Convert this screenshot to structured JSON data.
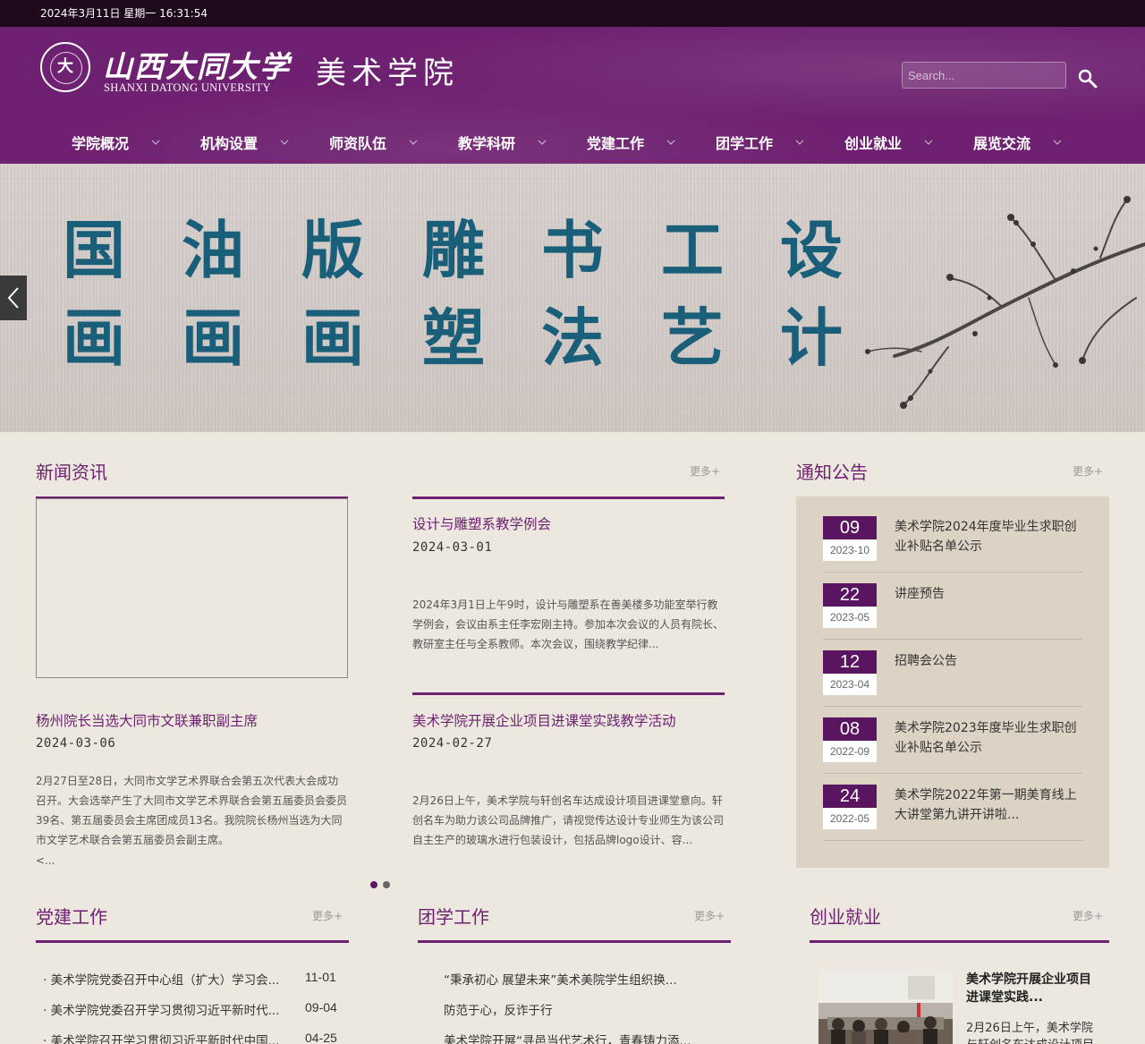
{
  "topbar": {
    "datetime": "2024年3月11日 星期一 16:31:54"
  },
  "header": {
    "logo_cn": "山西大同大学",
    "logo_en": "SHANXI DATONG UNIVERSITY",
    "college": "美术学院",
    "search_placeholder": "Search...",
    "brand_color": "#6e2170"
  },
  "nav": {
    "items": [
      {
        "label": "学院概况"
      },
      {
        "label": "机构设置"
      },
      {
        "label": "师资队伍"
      },
      {
        "label": "教学科研"
      },
      {
        "label": "党建工作"
      },
      {
        "label": "团学工作"
      },
      {
        "label": "创业就业"
      },
      {
        "label": "展览交流"
      }
    ]
  },
  "banner": {
    "columns": [
      [
        "国",
        "画"
      ],
      [
        "油",
        "画"
      ],
      [
        "版",
        "画"
      ],
      [
        "雕",
        "塑"
      ],
      [
        "书",
        "法"
      ],
      [
        "工",
        "艺"
      ],
      [
        "设",
        "计"
      ]
    ]
  },
  "news": {
    "title": "新闻资讯",
    "more": "更多+",
    "items": [
      {
        "title": "设计与雕塑系教学例会",
        "date": "2024-03-01",
        "body": "2024年3月1日上午9时，设计与雕塑系在善美楼多功能室举行教学例会，会议由系主任李宏刚主持。参加本次会议的人员有院长、教研室主任与全系教师。本次会议，围绕教学纪律..."
      },
      {
        "title": "杨州院长当选大同市文联兼职副主席",
        "date": "2024-03-06",
        "body": "2月27日至28日，大同市文学艺术界联合会第五次代表大会成功召开。大会选举产生了大同市文学艺术界联合会第五届委员会委员39名、第五届委员会主席团成员13名。我院院长杨州当选为大同市文学艺术联合会第五届委员会副主席。",
        "tail": "<..."
      },
      {
        "title": "美术学院开展企业项目进课堂实践教学活动",
        "date": "2024-02-27",
        "body": "2月26日上午，美术学院与轩创名车达成设计项目进课堂意向。轩创名车为助力该公司品牌推广，请视觉传达设计专业师生为该公司自主生产的玻璃水进行包装设计，包括品牌logo设计、容..."
      }
    ]
  },
  "notices": {
    "title": "通知公告",
    "more": "更多+",
    "items": [
      {
        "day": "09",
        "ym": "2023-10",
        "text": "美术学院2024年度毕业生求职创业补贴名单公示"
      },
      {
        "day": "22",
        "ym": "2023-05",
        "text": "讲座预告"
      },
      {
        "day": "12",
        "ym": "2023-04",
        "text": "招聘会公告"
      },
      {
        "day": "08",
        "ym": "2022-09",
        "text": "美术学院2023年度毕业生求职创业补贴名单公示"
      },
      {
        "day": "24",
        "ym": "2022-05",
        "text": "美术学院2022年第一期美育线上大讲堂第九讲开讲啦..."
      }
    ]
  },
  "party": {
    "title": "党建工作",
    "more": "更多+",
    "items": [
      {
        "text": "· 美术学院党委召开中心组（扩大）学习会...",
        "date": "11-01"
      },
      {
        "text": "· 美术学院党委召开学习贯彻习近平新时代...",
        "date": "09-04"
      },
      {
        "text": "· 美术学院召开学习贯彻习近平新时代中国...",
        "date": "04-25"
      }
    ]
  },
  "league": {
    "title": "团学工作",
    "more": "更多+",
    "items": [
      {
        "text": "“秉承初心 展望未来”美术美院学生组织换..."
      },
      {
        "text": "防范于心，反诈于行"
      },
      {
        "text": "美术学院开展“寻邑当代艺术行，青春铸力添..."
      }
    ]
  },
  "career": {
    "title": "创业就业",
    "more": "更多+",
    "feature_title": "美术学院开展企业项目进课堂实践...",
    "feature_body": "2月26日上午，美术学院与轩创名车达成设计项目"
  }
}
